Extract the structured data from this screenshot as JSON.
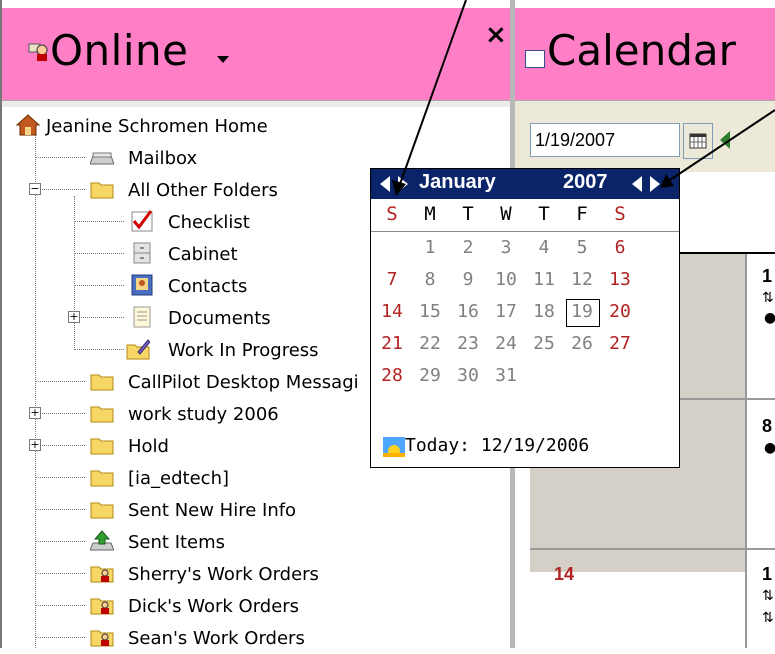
{
  "left_panel": {
    "title": "Online",
    "close_glyph": "×",
    "tree": [
      {
        "label": "Jeanine Schromen Home",
        "icon": "home-icon"
      },
      {
        "label": "Mailbox",
        "icon": "mailbox-icon"
      },
      {
        "label": "All Other Folders",
        "icon": "folder-icon",
        "expander": "−"
      },
      {
        "label": "Checklist",
        "icon": "checklist-icon"
      },
      {
        "label": "Cabinet",
        "icon": "cabinet-icon"
      },
      {
        "label": "Contacts",
        "icon": "contacts-icon"
      },
      {
        "label": "Documents",
        "icon": "documents-icon",
        "expander": "+"
      },
      {
        "label": "Work In Progress",
        "icon": "work-in-progress-icon"
      },
      {
        "label": "CallPilot Desktop Messagi",
        "icon": "folder-icon"
      },
      {
        "label": "work study 2006",
        "icon": "folder-icon",
        "expander": "+"
      },
      {
        "label": "Hold",
        "icon": "folder-icon",
        "expander": "+"
      },
      {
        "label": "[ia_edtech]",
        "icon": "folder-icon"
      },
      {
        "label": "Sent New Hire Info",
        "icon": "folder-icon"
      },
      {
        "label": "Sent Items",
        "icon": "sent-items-icon"
      },
      {
        "label": "Sherry's Work Orders",
        "icon": "shared-folder-icon"
      },
      {
        "label": "Dick's Work Orders",
        "icon": "shared-folder-icon"
      },
      {
        "label": "Sean's Work Orders",
        "icon": "shared-folder-icon"
      }
    ]
  },
  "right_panel": {
    "title": "Calendar",
    "date_value": "1/19/2007",
    "grid_days": [
      {
        "num": "1",
        "color": "#000000"
      },
      {
        "num": "8",
        "color": "#000000"
      },
      {
        "num": "14",
        "color": "#b22222"
      },
      {
        "num": "1",
        "color": "#000000"
      }
    ]
  },
  "popup": {
    "month": "January",
    "year": "2007",
    "weekdays": [
      "S",
      "M",
      "T",
      "W",
      "T",
      "F",
      "S"
    ],
    "weeks": [
      [
        "",
        "1",
        "2",
        "3",
        "4",
        "5",
        "6"
      ],
      [
        "7",
        "8",
        "9",
        "10",
        "11",
        "12",
        "13"
      ],
      [
        "14",
        "15",
        "16",
        "17",
        "18",
        "19",
        "20"
      ],
      [
        "21",
        "22",
        "23",
        "24",
        "25",
        "26",
        "27"
      ],
      [
        "28",
        "29",
        "30",
        "31",
        "",
        "",
        ""
      ]
    ],
    "selected": "19",
    "today_label": "Today: 12/19/2006"
  },
  "colors": {
    "header_pink": "#ff7fc6",
    "popup_header": "#0a246a",
    "weekend_red": "#b22222",
    "weekday_gray": "#808080"
  }
}
